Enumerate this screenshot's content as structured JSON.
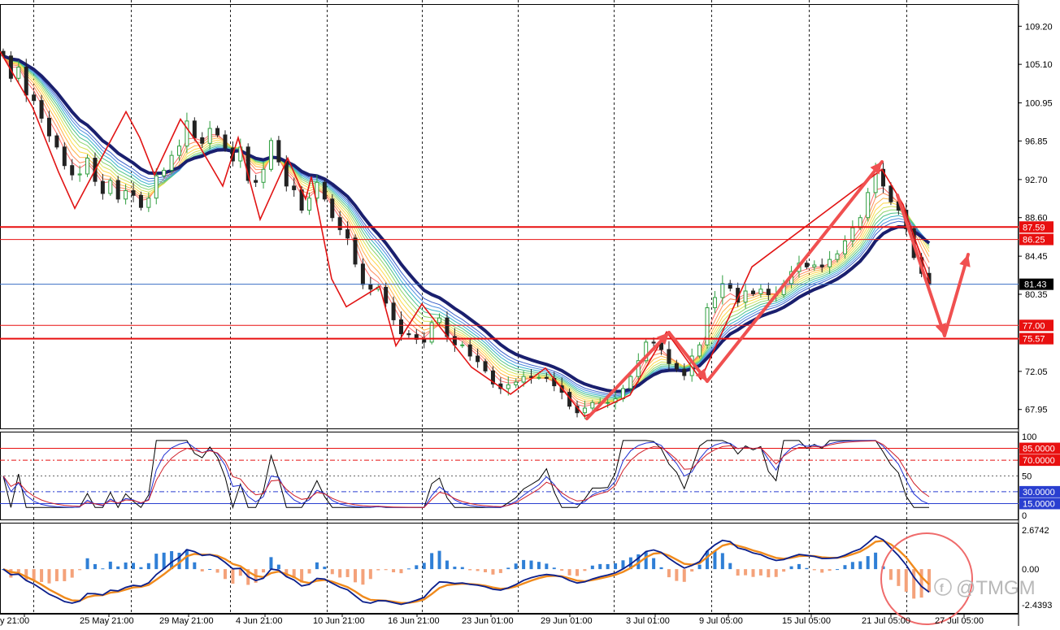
{
  "chart_data": {
    "type": "line",
    "x_ticks": [
      "y 21:00",
      "25 May 21:00",
      "29 May 21:00",
      "4 Jun 21:00",
      "10 Jun 21:00",
      "16 Jun 21:00",
      "23 Jun 01:00",
      "29 Jun 01:00",
      "3 Jul 01:00",
      "9 Jul 05:00",
      "15 Jul 05:00",
      "21 Jul 05:00",
      "27 Jul 05:00"
    ],
    "price_panel": {
      "ylim": [
        66.0,
        111.5
      ],
      "y_ticks": [
        "109.20",
        "105.10",
        "100.95",
        "96.85",
        "92.70",
        "88.60",
        "84.45",
        "80.35",
        "72.05",
        "67.95"
      ],
      "horizontal_levels": [
        {
          "value": 87.59,
          "label": "87.59",
          "color": "#e81010",
          "style": "solid-thick"
        },
        {
          "value": 86.25,
          "label": "86.25",
          "color": "#e81010",
          "style": "solid"
        },
        {
          "value": 77.0,
          "label": "77.00",
          "color": "#e81010",
          "style": "solid"
        },
        {
          "value": 75.57,
          "label": "75.57",
          "color": "#e81010",
          "style": "solid-thick"
        }
      ],
      "current_price": {
        "value": 81.43,
        "label": "81.43",
        "line_color": "#3a6fc4"
      },
      "close_series": [
        106.0,
        103.6,
        104.8,
        101.8,
        101.2,
        99.3,
        97.4,
        96.2,
        94.2,
        93.2,
        93.3,
        95.0,
        92.5,
        91.2,
        92.6,
        90.6,
        91.5,
        91.0,
        89.7,
        90.7,
        93.1,
        93.7,
        95.3,
        96.3,
        99.0,
        97.2,
        96.6,
        98.2,
        97.5,
        96.1,
        94.7,
        96.2,
        92.6,
        92.4,
        93.8,
        96.9,
        94.6,
        92.0,
        91.6,
        89.4,
        90.7,
        92.4,
        90.6,
        88.6,
        87.3,
        86.4,
        83.6,
        81.4,
        80.9,
        81.1,
        79.4,
        77.6,
        76.1,
        76.0,
        75.5,
        75.2,
        77.3,
        77.8,
        75.8,
        74.9,
        74.9,
        73.7,
        73.1,
        72.1,
        70.7,
        70.2,
        70.6,
        70.9,
        71.5,
        71.4,
        71.4,
        71.3,
        70.5,
        69.8,
        68.3,
        67.6,
        68.1,
        68.7,
        68.7,
        68.7,
        69.1,
        70.2,
        71.5,
        73.2,
        75.2,
        75.1,
        74.4,
        72.9,
        72.3,
        71.6,
        73.7,
        74.9,
        78.9,
        80.0,
        81.5,
        81.0,
        79.5,
        80.7,
        80.4,
        80.9,
        80.3,
        80.3,
        81.5,
        82.8,
        83.7,
        83.3,
        83.5,
        83.3,
        84.1,
        84.7,
        86.1,
        87.5,
        88.6,
        91.3,
        93.8,
        92.0,
        90.3,
        89.4,
        87.4,
        84.3,
        82.6,
        81.4
      ]
    },
    "oscillator_panel": {
      "ylim": [
        0,
        100
      ],
      "y_ticks": [
        "100",
        "50",
        "0"
      ],
      "levels": [
        {
          "value": 85,
          "label": "85.0000",
          "color": "#e81010"
        },
        {
          "value": 70,
          "label": "70.0000",
          "color": "#e81010"
        },
        {
          "value": 30,
          "label": "30.0000",
          "color": "#2a3fd0"
        },
        {
          "value": 15,
          "label": "15.0000",
          "color": "#2a3fd0"
        }
      ]
    },
    "macd_panel": {
      "ylim": [
        -2.4393,
        2.6742
      ],
      "y_ticks": [
        "2.6742",
        "0.00",
        "-2.4393"
      ],
      "zero": 0,
      "histogram_colors": {
        "positive": "#2f7fd6",
        "negative": "#f4a27a"
      },
      "line_colors": {
        "main": "#0b1f8c",
        "signal": "#f08a1c"
      }
    },
    "annotations": {
      "zigzag_color": "#e11414",
      "arrow_color": "#f05050",
      "watermark": "@TMGM",
      "watermark_glyph": "f"
    },
    "colors": {
      "background": "#ffffff",
      "bull_candle": "#2e9e3e",
      "bear_candle": "#222222",
      "slow_ma": "#1a1f6e",
      "ribbon": [
        "#ff6a6a",
        "#ff8c5a",
        "#ffb347",
        "#ffd84a",
        "#d4e157",
        "#8bd36b",
        "#4cc38a",
        "#38b2c9",
        "#4f8fe0",
        "#3a5fc8"
      ]
    }
  }
}
